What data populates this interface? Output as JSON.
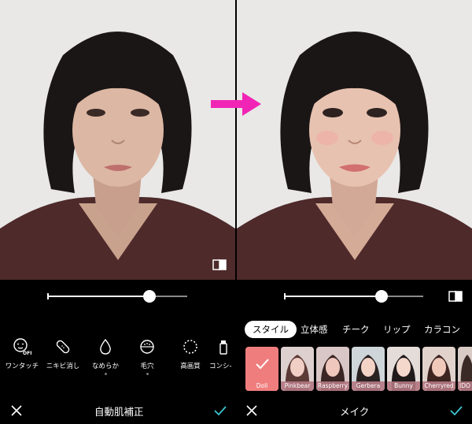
{
  "colors": {
    "accent": "#39c6d0",
    "arrow": "#f025b6",
    "doll": "#f07d7d"
  },
  "left_panel": {
    "slider": {
      "value": 0.73
    },
    "tools": [
      {
        "icon": "one-touch-off-icon",
        "label": "ワンタッチ"
      },
      {
        "icon": "bandage-icon",
        "label": "ニキビ消し"
      },
      {
        "icon": "water-drop-icon",
        "label": "なめらか"
      },
      {
        "icon": "pores-icon",
        "label": "毛穴"
      },
      {
        "icon": "dotted-circle-icon",
        "label": "高画質"
      },
      {
        "icon": "concealer-icon",
        "label": "コンシ-"
      }
    ],
    "title": "自動肌補正"
  },
  "right_panel": {
    "slider": {
      "value": 0.7
    },
    "tabs": [
      "スタイル",
      "立体感",
      "チーク",
      "リップ",
      "カラコン"
    ],
    "styles": [
      "Doll",
      "Pinkbear",
      "Raspberry",
      "Gerbera",
      "Bunny",
      "Cherryred",
      "IDO"
    ],
    "title": "メイク"
  },
  "icons": {
    "cancel": "close-icon",
    "confirm": "check-icon",
    "compare": "compare-icon",
    "arrow": "arrow-right-icon"
  }
}
